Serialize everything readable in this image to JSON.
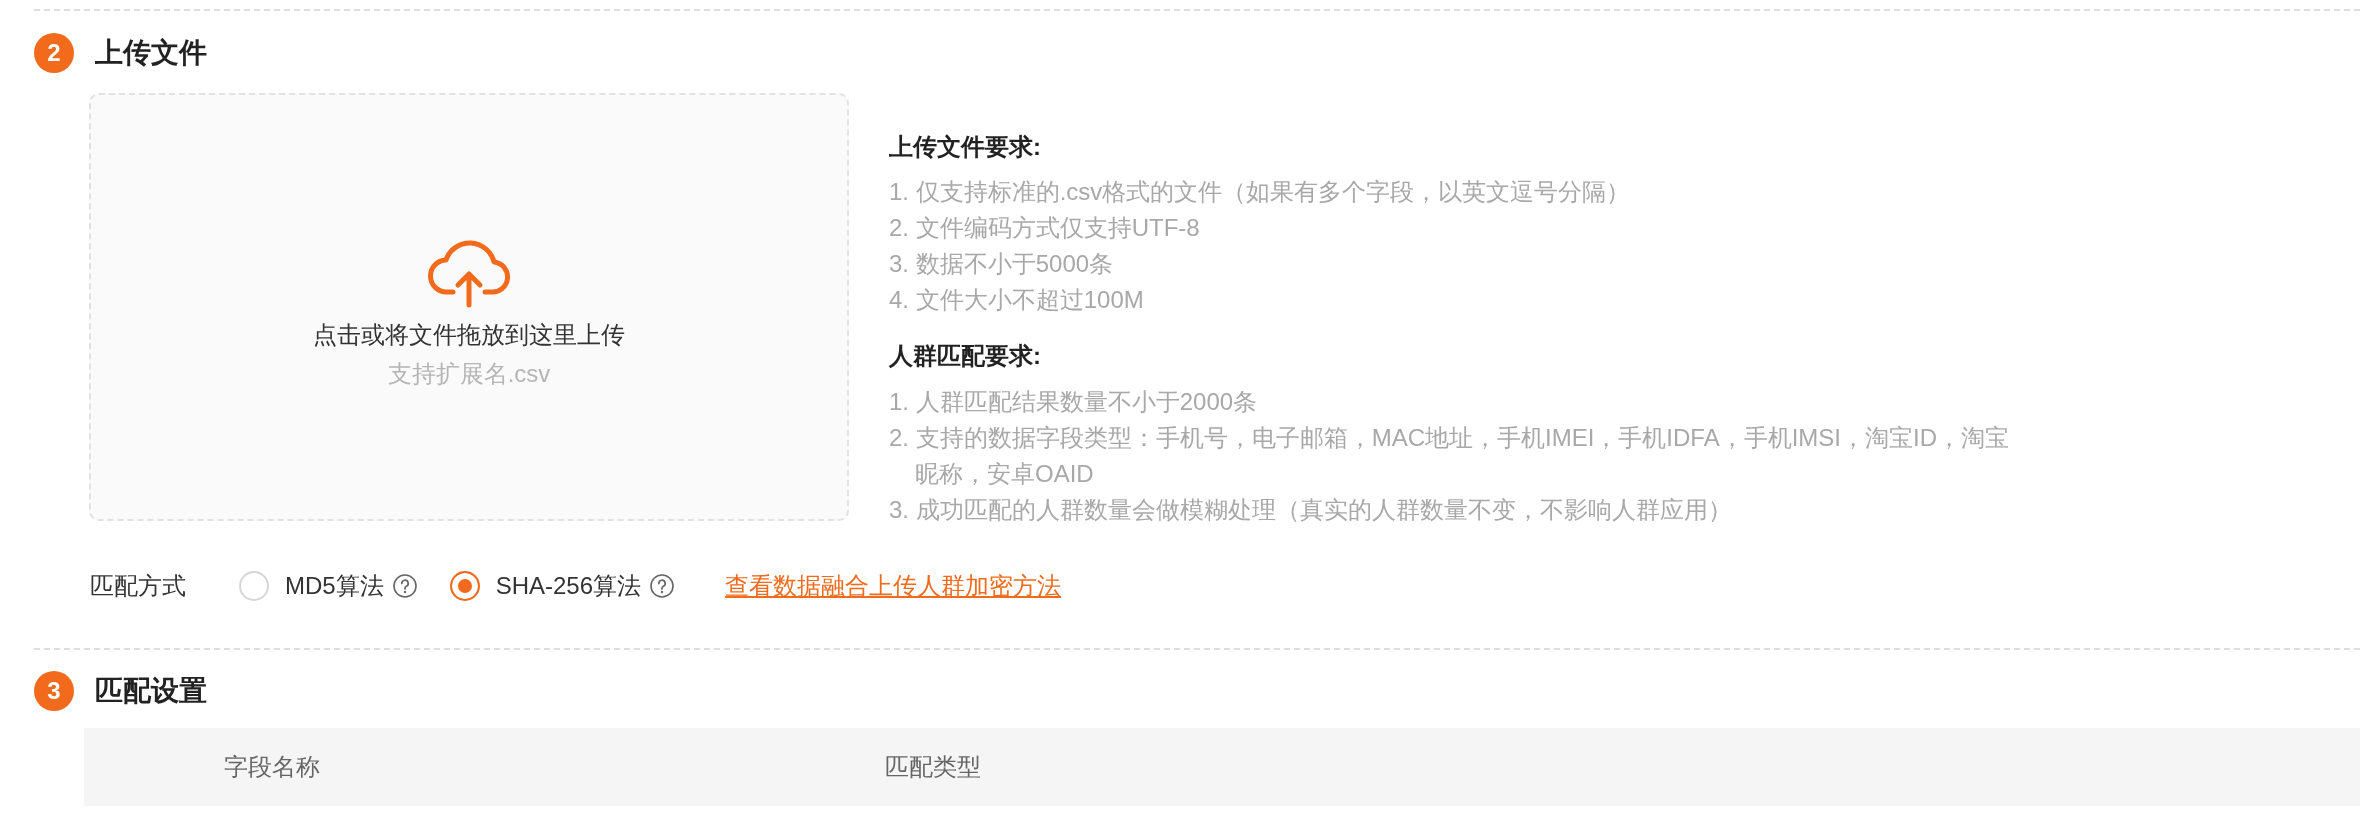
{
  "upload_section": {
    "step": "2",
    "title": "上传文件",
    "dropzone": {
      "prompt": "点击或将文件拖放到这里上传",
      "hint": "支持扩展名.csv"
    },
    "requirements": [
      {
        "heading": "上传文件要求:",
        "items": [
          "1. 仅支持标准的.csv格式的文件（如果有多个字段，以英文逗号分隔）",
          "2. 文件编码方式仅支持UTF-8",
          "3. 数据不小于5000条",
          "4. 文件大小不超过100M"
        ]
      },
      {
        "heading": "人群匹配要求:",
        "items": [
          "1. 人群匹配结果数量不小于2000条",
          "2. 支持的数据字段类型：手机号，电子邮箱，MAC地址，手机IMEI，手机IDFA，手机IMSI，淘宝ID，淘宝昵称，安卓OAID",
          "3. 成功匹配的人群数量会做模糊处理（真实的人群数量不变，不影响人群应用）"
        ]
      }
    ],
    "match_method": {
      "label": "匹配方式",
      "options": [
        {
          "label": "MD5算法",
          "selected": false
        },
        {
          "label": "SHA-256算法",
          "selected": true
        }
      ],
      "link": "查看数据融合上传人群加密方法"
    }
  },
  "match_section": {
    "step": "3",
    "title": "匹配设置",
    "table": {
      "columns": [
        "字段名称",
        "匹配类型"
      ]
    }
  }
}
